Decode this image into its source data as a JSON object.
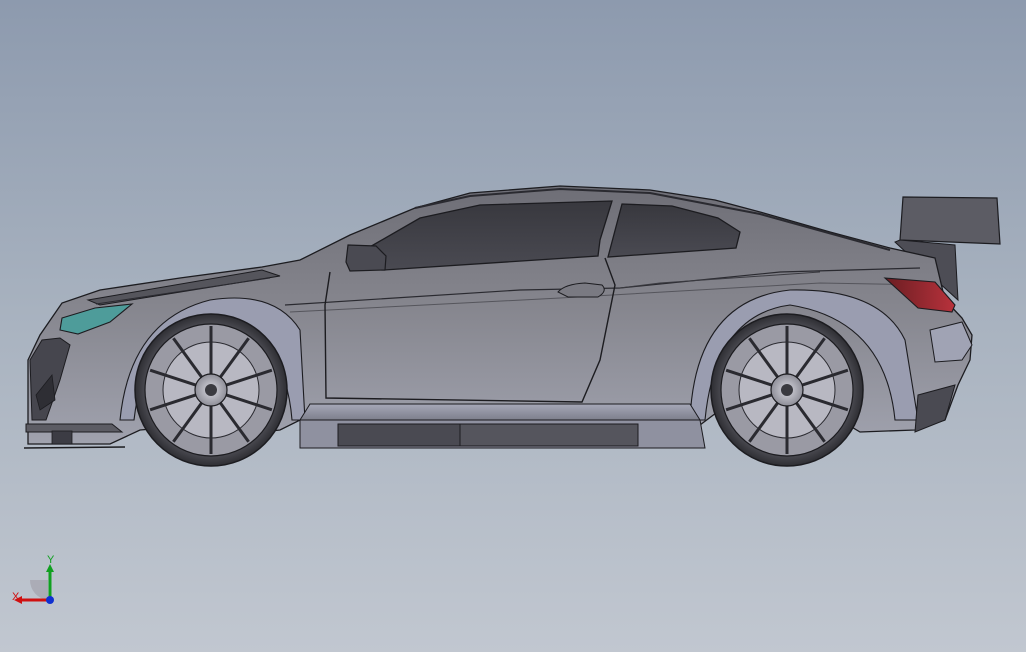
{
  "viewport": {
    "model": "race-car-side-view",
    "background_top": "#8d9aae",
    "background_bottom": "#c1c7d0"
  },
  "triad": {
    "x_label": "X",
    "y_label": "Y",
    "x_color": "#d01010",
    "y_color": "#10a020",
    "z_color": "#1030d0"
  }
}
